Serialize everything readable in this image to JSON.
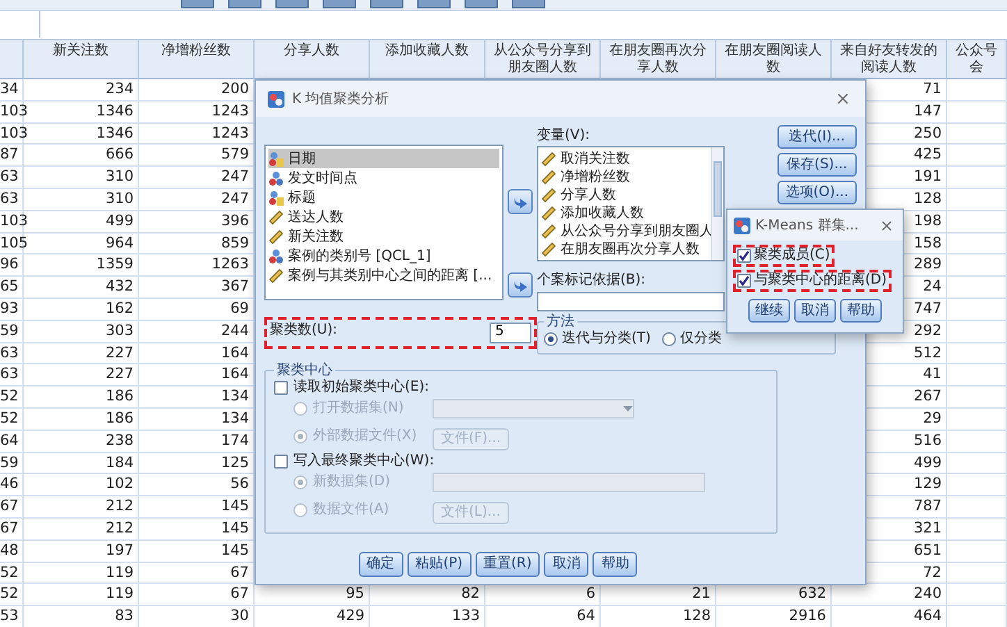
{
  "table": {
    "columns": [
      "",
      "新关注数",
      "净增粉丝数",
      "分享人数",
      "添加收藏人数",
      "从公众号分享到朋友圈人数",
      "在朋友圈再次分享人数",
      "在朋友圈阅读人数",
      "来自好友转发的阅读人数",
      "公众号会"
    ],
    "rows": [
      [
        "34",
        "234",
        "200",
        null,
        null,
        null,
        null,
        null,
        "71"
      ],
      [
        "103",
        "1346",
        "1243",
        null,
        null,
        null,
        null,
        null,
        "147"
      ],
      [
        "103",
        "1346",
        "1243",
        null,
        null,
        null,
        null,
        null,
        "250"
      ],
      [
        "87",
        "666",
        "579",
        null,
        null,
        null,
        null,
        null,
        "425"
      ],
      [
        "63",
        "310",
        "247",
        null,
        null,
        null,
        null,
        null,
        "191"
      ],
      [
        "63",
        "310",
        "247",
        null,
        null,
        null,
        null,
        null,
        "128"
      ],
      [
        "103",
        "499",
        "396",
        null,
        null,
        null,
        null,
        null,
        "198"
      ],
      [
        "105",
        "964",
        "859",
        null,
        null,
        null,
        null,
        null,
        "158"
      ],
      [
        "96",
        "1359",
        "1263",
        null,
        null,
        null,
        null,
        null,
        "289"
      ],
      [
        "65",
        "432",
        "367",
        null,
        null,
        null,
        null,
        null,
        "24"
      ],
      [
        "93",
        "162",
        "69",
        null,
        null,
        null,
        null,
        null,
        "747"
      ],
      [
        "59",
        "303",
        "244",
        null,
        null,
        null,
        null,
        null,
        "292"
      ],
      [
        "63",
        "227",
        "164",
        null,
        null,
        null,
        null,
        null,
        "512"
      ],
      [
        "63",
        "227",
        "164",
        null,
        null,
        null,
        null,
        null,
        "41"
      ],
      [
        "52",
        "186",
        "134",
        null,
        null,
        null,
        null,
        null,
        "267"
      ],
      [
        "52",
        "186",
        "134",
        null,
        null,
        null,
        null,
        null,
        "29"
      ],
      [
        "64",
        "238",
        "174",
        null,
        null,
        null,
        null,
        null,
        "516"
      ],
      [
        "59",
        "184",
        "125",
        null,
        null,
        null,
        null,
        null,
        "499"
      ],
      [
        "46",
        "102",
        "56",
        null,
        null,
        null,
        null,
        null,
        "129"
      ],
      [
        "67",
        "212",
        "145",
        null,
        null,
        null,
        null,
        null,
        "787"
      ],
      [
        "67",
        "212",
        "145",
        null,
        null,
        null,
        null,
        null,
        "321"
      ],
      [
        "48",
        "197",
        "145",
        null,
        null,
        null,
        null,
        null,
        "651"
      ],
      [
        "52",
        "119",
        "67",
        null,
        null,
        null,
        null,
        null,
        "72"
      ],
      [
        "52",
        "119",
        "67",
        "95",
        "82",
        "6",
        "21",
        "632",
        "240"
      ],
      [
        "53",
        "83",
        "30",
        "429",
        "133",
        "64",
        "128",
        "2916",
        "464"
      ]
    ]
  },
  "dialog": {
    "title": "K 均值聚类分析",
    "source_variables": [
      {
        "name": "日期",
        "kind": "string",
        "selected": true
      },
      {
        "name": "发文时间点",
        "kind": "nominal",
        "selected": false
      },
      {
        "name": "标题",
        "kind": "string",
        "selected": false
      },
      {
        "name": "送达人数",
        "kind": "scale",
        "selected": false
      },
      {
        "name": "新关注数",
        "kind": "scale",
        "selected": false
      },
      {
        "name": "案例的类别号 [QCL_1]",
        "kind": "nominal",
        "selected": false
      },
      {
        "name": "案例与其类别中心之间的距离 [...",
        "kind": "scale",
        "selected": false
      }
    ],
    "variables_label": "变量(V):",
    "variables": [
      {
        "name": "取消关注数",
        "kind": "scale"
      },
      {
        "name": "净增粉丝数",
        "kind": "scale"
      },
      {
        "name": "分享人数",
        "kind": "scale"
      },
      {
        "name": "添加收藏人数",
        "kind": "scale"
      },
      {
        "name": "从公众号分享到朋友圈人",
        "kind": "scale"
      },
      {
        "name": "在朋友圈再次分享人数",
        "kind": "scale"
      }
    ],
    "side_buttons": [
      "迭代(I)...",
      "保存(S)...",
      "选项(O)..."
    ],
    "label_by_label": "个案标记依据(B):",
    "clusters": {
      "label": "聚类数(U):",
      "value": "5",
      "highlighted": true
    },
    "method": {
      "title": "方法",
      "options": [
        {
          "label": "迭代与分类(T)",
          "selected": true
        },
        {
          "label": "仅分类",
          "selected": false
        }
      ]
    },
    "centers": {
      "title": "聚类中心",
      "read": {
        "label": "读取初始聚类中心(E):",
        "checked": false,
        "disabled": true,
        "options": [
          {
            "label": "打开数据集(N)",
            "selected": false
          },
          {
            "label": "外部数据文件(X)",
            "selected": true
          }
        ],
        "file_button": "文件(F)..."
      },
      "write": {
        "label": "写入最终聚类中心(W):",
        "checked": false,
        "disabled": true,
        "options": [
          {
            "label": "新数据集(D)",
            "selected": true
          },
          {
            "label": "数据文件(A)",
            "selected": false
          }
        ],
        "file_button": "文件(L)..."
      }
    },
    "buttons": [
      "确定",
      "粘贴(P)",
      "重置(R)",
      "取消",
      "帮助"
    ]
  },
  "subdialog": {
    "title": "K-Means 群集...",
    "options": [
      {
        "label": "聚类成员(C)",
        "checked": true,
        "highlighted": true
      },
      {
        "label": "与聚类中心的距离(D)",
        "checked": true,
        "highlighted": true
      }
    ],
    "buttons": [
      "继续",
      "取消",
      "帮助"
    ]
  }
}
